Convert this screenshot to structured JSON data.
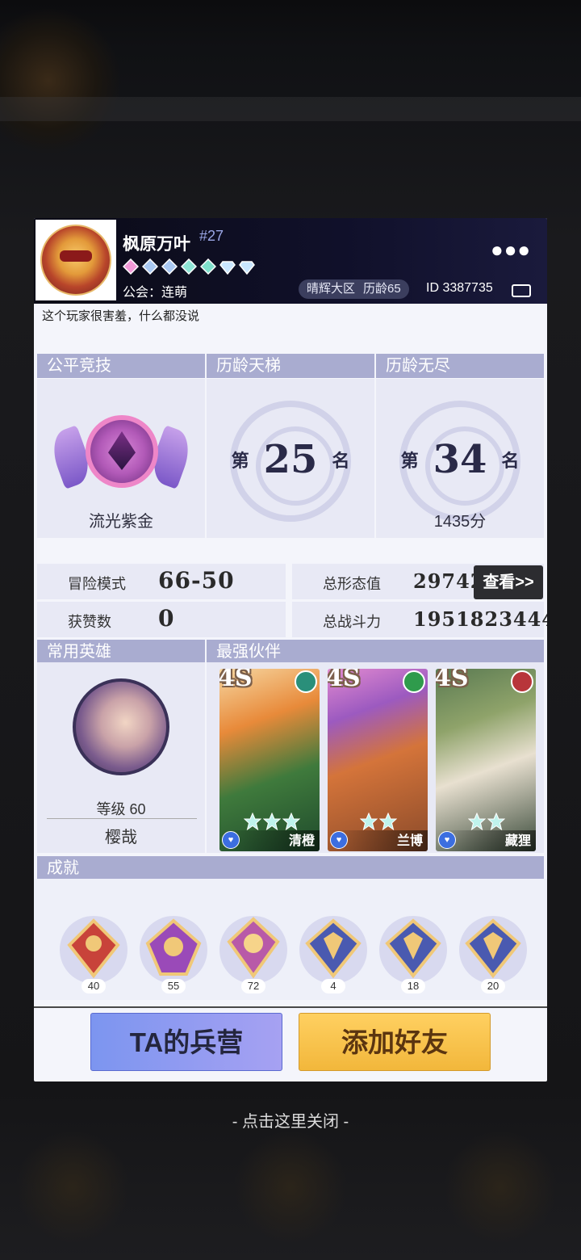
{
  "profile": {
    "name": "枫原万叶",
    "rank_no": "#27",
    "guild": "公会：连萌",
    "zone": "晴辉大区",
    "age": "历龄65",
    "uid": "ID 3387735",
    "motto": "这个玩家很害羞，什么都没说",
    "more_icon": "more-dots-icon"
  },
  "sections": {
    "fair": "公平竞技",
    "ladder": "历龄天梯",
    "endless": "历龄无尽",
    "common_hero": "常用英雄",
    "partners": "最强伙伴",
    "achievements": "成就"
  },
  "rank": {
    "fair_tier": "流光紫金",
    "ladder_pre": "第",
    "ladder_num": "25",
    "ladder_suf": "名",
    "endless_pre": "第",
    "endless_num": "34",
    "endless_suf": "名",
    "endless_score": "1435分"
  },
  "stats": {
    "adventure_label": "冒险模式",
    "adventure_value": "66-50",
    "likes_label": "获赞数",
    "likes_value": "0",
    "form_label": "总形态值",
    "form_value": "29742",
    "power_label": "总战斗力",
    "power_value": "1951823444",
    "view_label": "查看>>"
  },
  "hero": {
    "level": "等级 60",
    "name": "樱哉"
  },
  "partners": [
    {
      "grade": "4S",
      "name": "清橙",
      "stars": 3
    },
    {
      "grade": "4S",
      "name": "兰博",
      "stars": 2
    },
    {
      "grade": "4S",
      "name": "藏狸",
      "stars": 2
    }
  ],
  "achievements": [
    "40",
    "55",
    "72",
    "4",
    "18",
    "20"
  ],
  "buttons": {
    "barracks": "TA的兵营",
    "add_friend": "添加好友"
  },
  "close_hint": "- 点击这里关闭 -",
  "colors": {
    "section_header": "#a9acd0",
    "panel": "#e8e9f5",
    "header_bg": "#10102a",
    "btn_blue": "#8fa0f0",
    "btn_gold": "#f7c24c"
  }
}
